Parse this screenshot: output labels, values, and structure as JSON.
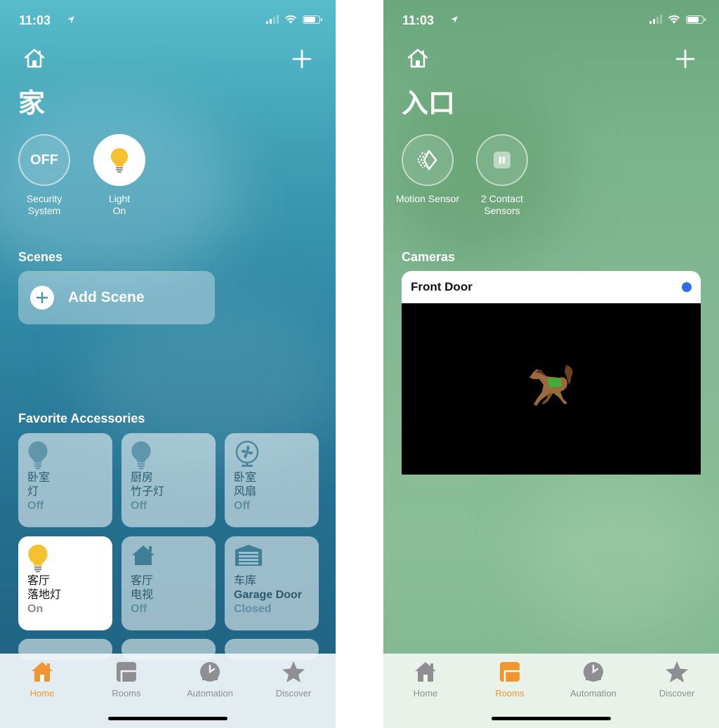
{
  "left": {
    "status": {
      "time": "11:03"
    },
    "title": "家",
    "status_tiles": [
      {
        "circle": "OFF",
        "label_line1": "Security",
        "label_line2": "System"
      },
      {
        "label_line1": "Light",
        "label_line2": "On"
      }
    ],
    "scenes": {
      "title": "Scenes",
      "add_label": "Add Scene"
    },
    "favorites": {
      "title": "Favorite Accessories",
      "items": [
        {
          "line1": "卧室",
          "line2": "灯",
          "state": "Off",
          "icon": "lightbulb-icon"
        },
        {
          "line1": "厨房",
          "line2": "竹子灯",
          "state": "Off",
          "icon": "lightbulb-icon"
        },
        {
          "line1": "卧室",
          "line2": "风扇",
          "state": "Off",
          "icon": "fan-icon"
        },
        {
          "line1": "客厅",
          "line2": "落地灯",
          "state": "On",
          "icon": "lightbulb-icon"
        },
        {
          "line1": "客厅",
          "line2": "电视",
          "state": "Off",
          "icon": "house-icon"
        },
        {
          "line1": "车库",
          "line2": "Garage Door",
          "state": "Closed",
          "icon": "garage-icon"
        }
      ]
    },
    "tabs": [
      {
        "label": "Home",
        "active": true
      },
      {
        "label": "Rooms",
        "active": false
      },
      {
        "label": "Automation",
        "active": false
      },
      {
        "label": "Discover",
        "active": false
      }
    ]
  },
  "right": {
    "status": {
      "time": "11:03"
    },
    "title": "入口",
    "status_tiles": [
      {
        "label_line1": "Motion Sensor",
        "label_line2": ""
      },
      {
        "label_line1": "2 Contact",
        "label_line2": "Sensors"
      }
    ],
    "cameras": {
      "title": "Cameras",
      "camera_name": "Front Door"
    },
    "tabs": [
      {
        "label": "Home",
        "active": false
      },
      {
        "label": "Rooms",
        "active": true
      },
      {
        "label": "Automation",
        "active": false
      },
      {
        "label": "Discover",
        "active": false
      }
    ]
  },
  "colors": {
    "accent_orange": "#f0962e",
    "bulb_yellow": "#f5c12e",
    "live_blue": "#2f6fe6"
  }
}
